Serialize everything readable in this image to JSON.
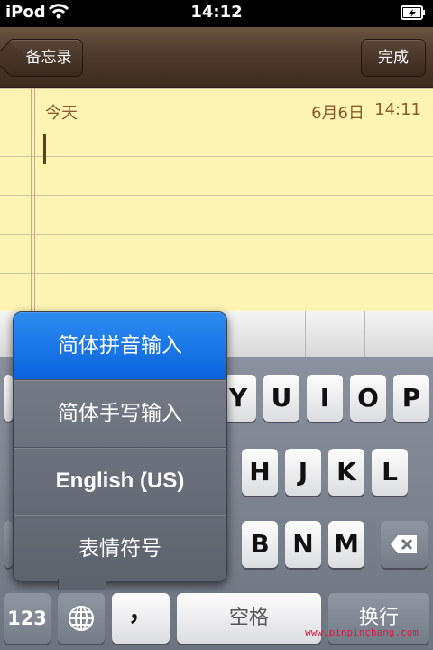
{
  "status_bar": {
    "device": "iPod",
    "time": "14:12"
  },
  "nav": {
    "back_label": "备忘录",
    "done_label": "完成"
  },
  "note": {
    "date_label": "今天",
    "date_value": "6月6日",
    "time_value": "14:11"
  },
  "keyboard": {
    "row1": [
      "Y",
      "U",
      "I",
      "O",
      "P"
    ],
    "row2": [
      "H",
      "J",
      "K",
      "L"
    ],
    "row3": [
      "B",
      "N",
      "M"
    ],
    "numbers_label": "123",
    "comma_label": "，",
    "space_label": "空格",
    "return_label": "换行"
  },
  "input_menu": {
    "options": [
      "简体拼音输入",
      "简体手写输入",
      "English (US)",
      "表情符号"
    ],
    "selected_index": 0
  },
  "watermark": "www.pinpinchang.com",
  "colors": {
    "selected": "#1a73e8",
    "note_paper": "#fdf4b3",
    "nav": "#4e3b2d"
  }
}
